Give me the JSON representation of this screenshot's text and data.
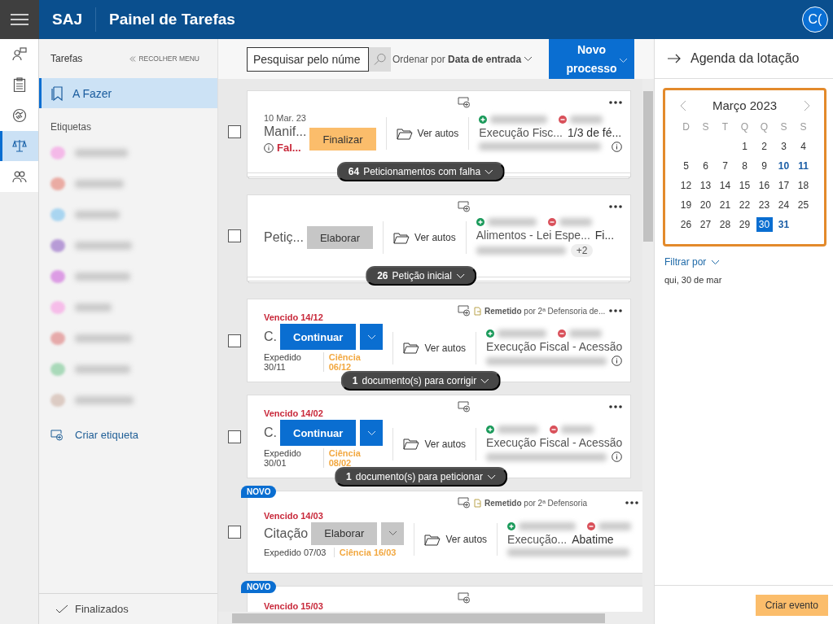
{
  "header": {
    "brand": "SAJ",
    "title": "Painel de Tarefas",
    "avatar": "C("
  },
  "rail": [
    {
      "kind": "person-chat",
      "selected": false
    },
    {
      "kind": "clipboard",
      "selected": false
    },
    {
      "kind": "handshake",
      "selected": false
    },
    {
      "kind": "scales",
      "selected": true
    },
    {
      "kind": "people",
      "selected": false
    }
  ],
  "sidebar": {
    "title": "Tarefas",
    "collapse": "RECOLHER MENU",
    "items": [
      {
        "label": "A Fazer",
        "selected": true
      }
    ],
    "tags_title": "Etiquetas",
    "tags": [
      {
        "color": "#f4b9e8"
      },
      {
        "color": "#eaaba3"
      },
      {
        "color": "#a9d5f0"
      },
      {
        "color": "#b79bd6"
      },
      {
        "color": "#dc9ce4"
      },
      {
        "color": "#f6bde9"
      },
      {
        "color": "#e6aaaa"
      },
      {
        "color": "#a9d9b9"
      },
      {
        "color": "#dccbc3"
      }
    ],
    "create_tag": "Criar etiqueta",
    "footer": "Finalizados"
  },
  "toolbar": {
    "search_placeholder": "Pesquisar pelo núme",
    "sort_label": "Ordenar por",
    "sort_value": "Data de entrada",
    "new_button": "Novo processo"
  },
  "tasks": [
    {
      "checked": false,
      "stacked": true,
      "info": true,
      "date": "10 Mar. 23",
      "title": "Manif...",
      "error": "Fal...",
      "action": {
        "label": "Finalizar",
        "kind": "warning",
        "split": false
      },
      "view": "Ver autos",
      "subject": "Execução Fisc...",
      "subject_detail": "1/3 de fé...",
      "pill": "**64** Peticionamentos com falha"
    },
    {
      "checked": false,
      "stacked": true,
      "info": false,
      "title": "Petiç...",
      "action": {
        "label": "Elaborar",
        "kind": "neutral",
        "split": false
      },
      "view": "Ver autos",
      "subject": "Alimentos - Lei Espe...",
      "subject_detail": "Fi...",
      "extra": "+2",
      "pill": "**26** Petição inicial"
    },
    {
      "checked": false,
      "stacked": false,
      "info": true,
      "due": "Vencido 14/12",
      "title": "C.",
      "action": {
        "label": "Continuar",
        "kind": "primary",
        "split": true
      },
      "view": "Ver autos",
      "expedido": "Expedido 30/11",
      "ciencia": "Ciência 06/12",
      "remetido": "Remetido",
      "remetido_by": "por 2ª Defensoria de...",
      "subject": "Execução Fiscal - Acessão",
      "pill": "**1** documento(s) para corrigir"
    },
    {
      "checked": false,
      "stacked": false,
      "info": true,
      "due": "Vencido 14/02",
      "title": "C.",
      "action": {
        "label": "Continuar",
        "kind": "primary",
        "split": true
      },
      "view": "Ver autos",
      "expedido": "Expedido 30/01",
      "ciencia": "Ciência 08/02",
      "subject": "Execução Fiscal - Acessão",
      "pill": "**1** documento(s) para peticionar"
    },
    {
      "checked": false,
      "stacked": false,
      "info": false,
      "flag": "NOVO",
      "due": "Vencido 14/03",
      "title": "Citação",
      "action": {
        "label": "Elaborar",
        "kind": "neutral",
        "split": true
      },
      "view": "Ver autos",
      "expedido": "Expedido 07/03",
      "ciencia": "Ciência 16/03",
      "remetido": "Remetido",
      "remetido_by": "por 2ª Defensoria",
      "subject": "Execução...",
      "subject_detail": "Abatime"
    },
    {
      "stacked": false,
      "flag": "NOVO",
      "due": "Vencido 15/03"
    }
  ],
  "agenda": {
    "title": "Agenda da lotação",
    "month": "Março 2023",
    "weekdays": [
      "D",
      "S",
      "T",
      "Q",
      "Q",
      "S",
      "S"
    ],
    "weeks": [
      [
        {
          "day": "1",
          "selected": false,
          "marked": false
        },
        {
          "day": "2",
          "selected": false,
          "marked": false
        },
        {
          "day": "3",
          "selected": false,
          "marked": false
        },
        {
          "day": "4",
          "selected": false,
          "marked": false
        }
      ],
      [
        {
          "day": "5",
          "selected": false,
          "marked": false
        },
        {
          "day": "6",
          "selected": false,
          "marked": false
        },
        {
          "day": "7",
          "selected": false,
          "marked": false
        },
        {
          "day": "8",
          "selected": false,
          "marked": false
        },
        {
          "day": "9",
          "selected": false,
          "marked": false
        },
        {
          "day": "10",
          "selected": false,
          "marked": true
        },
        {
          "day": "11",
          "selected": false,
          "marked": true
        }
      ],
      [
        {
          "day": "12",
          "selected": false,
          "marked": false
        },
        {
          "day": "13",
          "selected": false,
          "marked": false
        },
        {
          "day": "14",
          "selected": false,
          "marked": false
        },
        {
          "day": "15",
          "selected": false,
          "marked": false
        },
        {
          "day": "16",
          "selected": false,
          "marked": false
        },
        {
          "day": "17",
          "selected": false,
          "marked": false
        },
        {
          "day": "18",
          "selected": false,
          "marked": false
        }
      ],
      [
        {
          "day": "19",
          "selected": false,
          "marked": false
        },
        {
          "day": "20",
          "selected": false,
          "marked": false
        },
        {
          "day": "21",
          "selected": false,
          "marked": false
        },
        {
          "day": "22",
          "selected": false,
          "marked": false
        },
        {
          "day": "23",
          "selected": false,
          "marked": false
        },
        {
          "day": "24",
          "selected": false,
          "marked": false
        },
        {
          "day": "25",
          "selected": false,
          "marked": false
        }
      ],
      [
        {
          "day": "26",
          "selected": false,
          "marked": false
        },
        {
          "day": "27",
          "selected": false,
          "marked": false
        },
        {
          "day": "28",
          "selected": false,
          "marked": false
        },
        {
          "day": "29",
          "selected": false,
          "marked": false
        },
        {
          "day": "30",
          "selected": true,
          "marked": false
        },
        {
          "day": "31",
          "selected": false,
          "marked": true
        }
      ]
    ],
    "filter": "Filtrar por",
    "date": "qui, 30 de mar",
    "create_event": "Criar evento"
  }
}
